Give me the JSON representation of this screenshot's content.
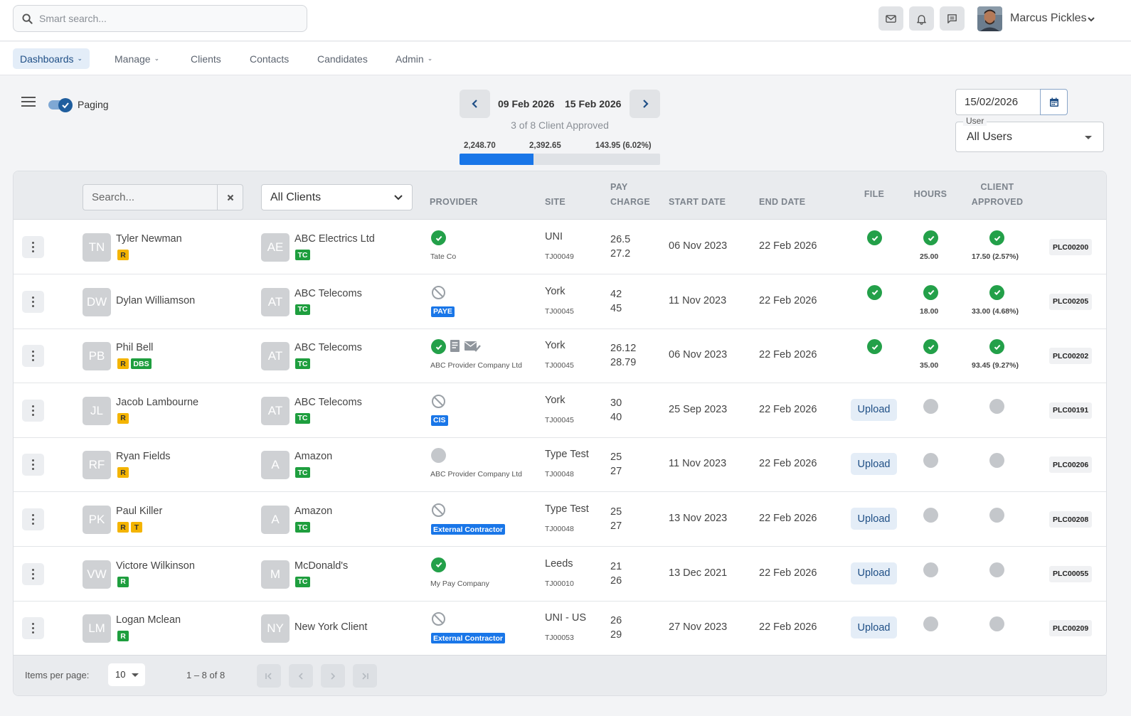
{
  "header": {
    "search_placeholder": "Smart search...",
    "user_name": "Marcus Pickles",
    "icons": [
      "mail-icon",
      "bell-icon",
      "message-icon"
    ]
  },
  "nav": {
    "items": [
      {
        "label": "Dashboards",
        "active": true,
        "dropdown": true
      },
      {
        "label": "Manage",
        "dropdown": true
      },
      {
        "label": "Clients"
      },
      {
        "label": "Contacts"
      },
      {
        "label": "Candidates"
      },
      {
        "label": "Admin",
        "dropdown": true
      }
    ]
  },
  "controls": {
    "paging_label": "Paging",
    "paging_on": true,
    "week_start": "09 Feb 2026",
    "week_end": "15 Feb 2026",
    "approved_note": "3 of 8 Client Approved",
    "progress": {
      "left": "2,248.70",
      "mid": "2,392.65",
      "right": "143.95 (6.02%)",
      "fraction": 0.37
    },
    "date_value": "15/02/2026",
    "user_label": "User",
    "user_value": "All Users"
  },
  "table": {
    "search_placeholder": "Search...",
    "client_filter": "All Clients",
    "headers": {
      "provider": "PROVIDER",
      "site": "SITE",
      "pay": "PAY",
      "charge": "CHARGE",
      "start_date": "START DATE",
      "end_date": "END DATE",
      "file": "FILE",
      "hours": "HOURS",
      "client": "CLIENT",
      "approved": "APPROVED"
    },
    "upload_label": "Upload",
    "rows": [
      {
        "initials": "TN",
        "name": "Tyler Newman",
        "badges": [
          "R"
        ],
        "client_initials": "AE",
        "client": "ABC Electrics Ltd",
        "client_badge": "TC",
        "provider_status": "check",
        "provider_text": "Tate Co",
        "site": "UNI",
        "job": "TJ00049",
        "pay": "26.5",
        "charge": "27.2",
        "start": "06 Nov 2023",
        "end": "22 Feb 2026",
        "file": "check",
        "hours_status": "check",
        "hours": "25.00",
        "approved_status": "check",
        "approved": "17.50 (2.57%)",
        "ref": "PLC00200"
      },
      {
        "initials": "DW",
        "name": "Dylan Williamson",
        "badges": [],
        "client_initials": "AT",
        "client": "ABC Telecoms",
        "client_badge": "TC",
        "provider_status": "ban",
        "provider_tag": "PAYE",
        "site": "York",
        "job": "TJ00045",
        "pay": "42",
        "charge": "45",
        "start": "11 Nov 2023",
        "end": "22 Feb 2026",
        "file": "check",
        "hours_status": "check",
        "hours": "18.00",
        "approved_status": "check",
        "approved": "33.00 (4.68%)",
        "ref": "PLC00205"
      },
      {
        "initials": "PB",
        "name": "Phil Bell",
        "badges": [
          "R",
          "DBS"
        ],
        "client_initials": "AT",
        "client": "ABC Telecoms",
        "client_badge": "TC",
        "provider_status": "check-docs",
        "provider_text": "ABC Provider Company Ltd",
        "site": "York",
        "job": "TJ00045",
        "pay": "26.12",
        "charge": "28.79",
        "start": "06 Nov 2023",
        "end": "22 Feb 2026",
        "file": "check",
        "hours_status": "check",
        "hours": "35.00",
        "approved_status": "check",
        "approved": "93.45 (9.27%)",
        "ref": "PLC00202"
      },
      {
        "initials": "JL",
        "name": "Jacob Lambourne",
        "badges": [
          "R"
        ],
        "client_initials": "AT",
        "client": "ABC Telecoms",
        "client_badge": "TC",
        "provider_status": "ban",
        "provider_tag": "CIS",
        "site": "York",
        "job": "TJ00045",
        "pay": "30",
        "charge": "40",
        "start": "25 Sep 2023",
        "end": "22 Feb 2026",
        "file": "upload",
        "hours_status": "gray",
        "approved_status": "gray",
        "ref": "PLC00191"
      },
      {
        "initials": "RF",
        "name": "Ryan Fields",
        "badges": [
          "R"
        ],
        "client_initials": "A",
        "client": "Amazon",
        "client_badge": "TC",
        "provider_status": "gray",
        "provider_text": "ABC Provider Company Ltd",
        "site": "Type Test",
        "job": "TJ00048",
        "pay": "25",
        "charge": "27",
        "start": "11 Nov 2023",
        "end": "22 Feb 2026",
        "file": "upload",
        "hours_status": "gray",
        "approved_status": "gray",
        "ref": "PLC00206"
      },
      {
        "initials": "PK",
        "name": "Paul Killer",
        "badges": [
          "R",
          "T"
        ],
        "client_initials": "A",
        "client": "Amazon",
        "client_badge": "TC",
        "provider_status": "ban",
        "provider_tag": "External Contractor",
        "site": "Type Test",
        "job": "TJ00048",
        "pay": "25",
        "charge": "27",
        "start": "13 Nov 2023",
        "end": "22 Feb 2026",
        "file": "upload",
        "hours_status": "gray",
        "approved_status": "gray",
        "ref": "PLC00208"
      },
      {
        "initials": "VW",
        "name": "Victore Wilkinson",
        "badges": [
          "R-green"
        ],
        "client_initials": "M",
        "client": "McDonald's",
        "client_badge": "TC",
        "provider_status": "check",
        "provider_text": "My Pay Company",
        "site": "Leeds",
        "job": "TJ00010",
        "pay": "21",
        "charge": "26",
        "start": "13 Dec 2021",
        "end": "22 Feb 2026",
        "file": "upload",
        "hours_status": "gray",
        "approved_status": "gray",
        "ref": "PLC00055"
      },
      {
        "initials": "LM",
        "name": "Logan Mclean",
        "badges": [
          "R-green"
        ],
        "client_initials": "NY",
        "client": "New York Client",
        "client_badge": "",
        "provider_status": "ban",
        "provider_tag": "External Contractor",
        "site": "UNI - US",
        "job": "TJ00053",
        "pay": "26",
        "charge": "29",
        "start": "27 Nov 2023",
        "end": "22 Feb 2026",
        "file": "upload",
        "hours_status": "gray",
        "approved_status": "gray",
        "ref": "PLC00209"
      }
    ]
  },
  "footer": {
    "items_per_page_label": "Items per page:",
    "items_per_page": "10",
    "range": "1 – 8 of 8"
  }
}
